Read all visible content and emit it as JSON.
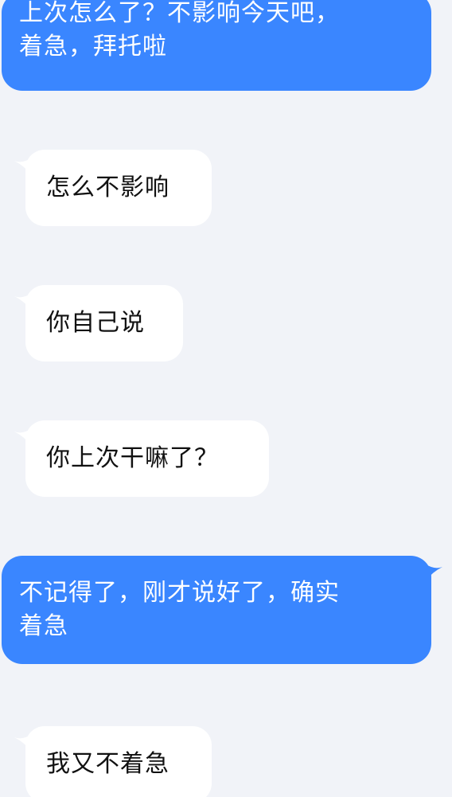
{
  "messages": [
    {
      "side": "out",
      "text": "上次怎么了？不影响今天吧，\n着急，拜托啦"
    },
    {
      "side": "in",
      "text": "怎么不影响"
    },
    {
      "side": "in",
      "text": "你自己说"
    },
    {
      "side": "in",
      "text": "你上次干嘛了？"
    },
    {
      "side": "out",
      "text": "不记得了，刚才说好了，确实\n着急"
    },
    {
      "side": "in",
      "text": "我又不着急"
    }
  ],
  "colors": {
    "background": "#f1f3f8",
    "outgoing_bubble": "#3a86ff",
    "incoming_bubble": "#ffffff"
  }
}
